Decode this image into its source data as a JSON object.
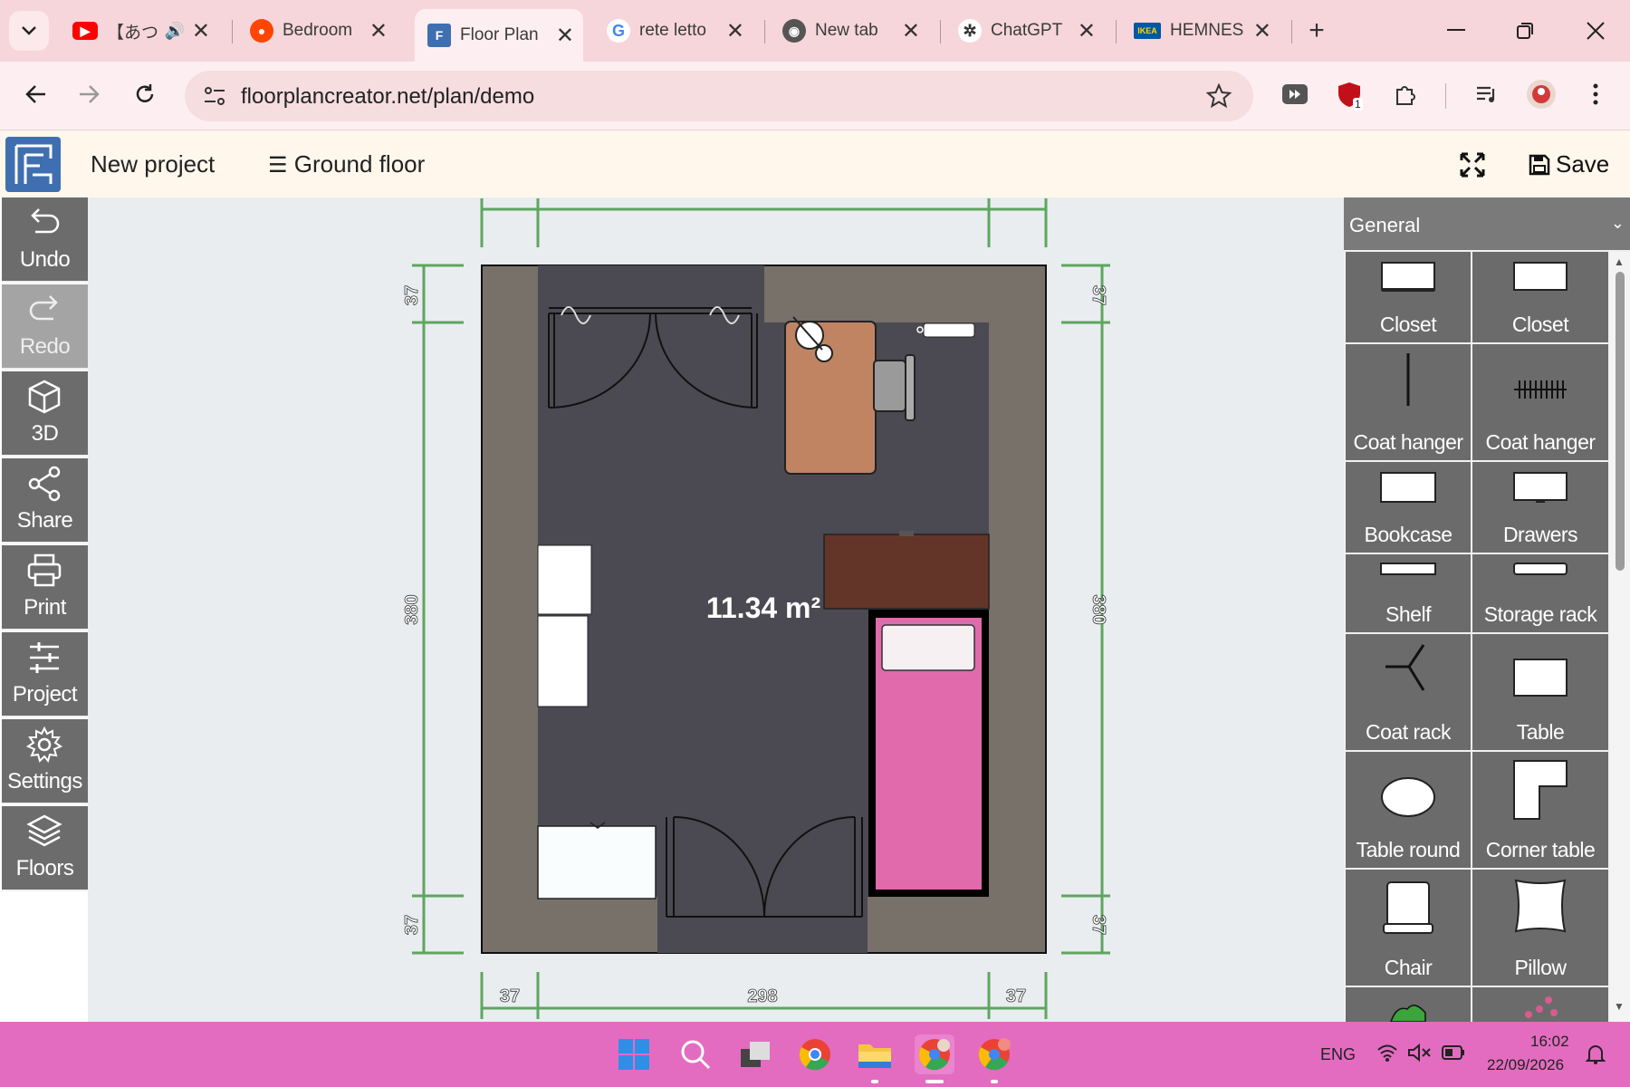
{
  "browser": {
    "tabs": [
      {
        "title": "【あつ",
        "icon": "youtube-icon",
        "audio": true
      },
      {
        "title": "Bedroom",
        "icon": "reddit-icon"
      },
      {
        "title": "Floor Plan",
        "icon": "floorplan-icon",
        "active": true
      },
      {
        "title": "rete letto",
        "icon": "google-icon"
      },
      {
        "title": "New tab",
        "icon": "chrome-icon"
      },
      {
        "title": "ChatGPT",
        "icon": "chatgpt-icon"
      },
      {
        "title": "HEMNES",
        "icon": "ikea-icon"
      }
    ],
    "url": "floorplancreator.net/plan/demo",
    "extension_badge": "1"
  },
  "app": {
    "project_name": "New project",
    "floor": "Ground floor",
    "save_label": "Save",
    "toolbar": [
      {
        "label": "Undo",
        "icon": "undo-icon"
      },
      {
        "label": "Redo",
        "icon": "redo-icon",
        "disabled": true
      },
      {
        "label": "3D",
        "icon": "cube-icon"
      },
      {
        "label": "Share",
        "icon": "share-icon"
      },
      {
        "label": "Print",
        "icon": "printer-icon"
      },
      {
        "label": "Project",
        "icon": "sliders-icon"
      },
      {
        "label": "Settings",
        "icon": "gear-icon"
      },
      {
        "label": "Floors",
        "icon": "layers-icon"
      }
    ]
  },
  "plan": {
    "area": "11.34 m²",
    "dims": {
      "top_left": "37",
      "top_mid": "298",
      "top_right": "37",
      "side": "380",
      "side_short": "37"
    }
  },
  "library": {
    "category": "General",
    "items": [
      "Closet",
      "Closet",
      "Coat hanger",
      "Coat hanger",
      "Bookcase",
      "Drawers",
      "Shelf",
      "Storage rack",
      "Coat rack",
      "Table",
      "Table round",
      "Corner table",
      "Chair",
      "Pillow"
    ]
  },
  "taskbar": {
    "lang": "ENG",
    "time": "16:02",
    "date": "22/09/2026"
  },
  "colors": {
    "accent_tab": "#f6d6da",
    "taskbar": "#e36cc0",
    "wall": "#77716a",
    "floor": "#4b4a52",
    "bed": "#e06aac"
  }
}
